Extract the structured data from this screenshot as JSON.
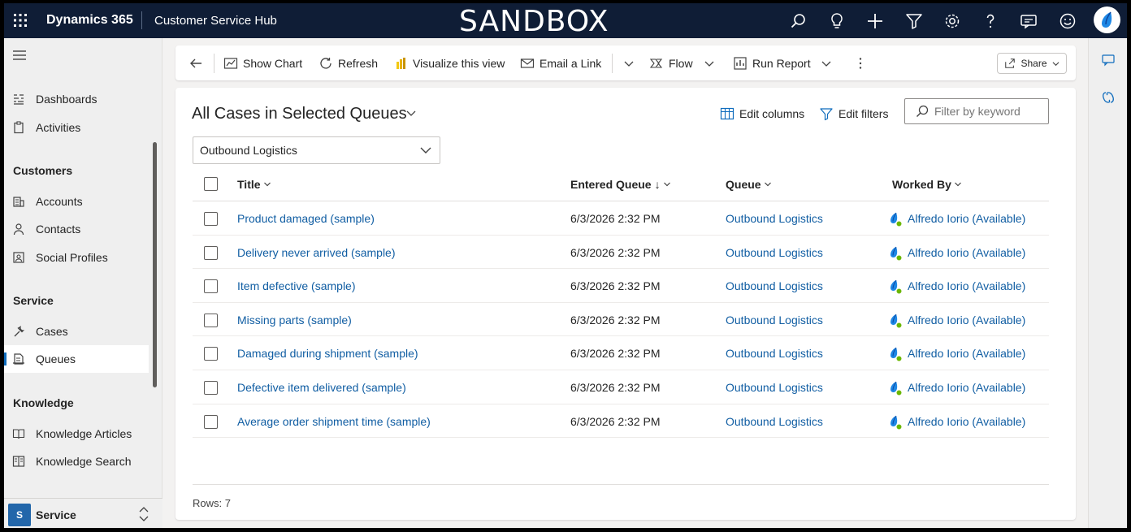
{
  "topbar": {
    "app_title": "Dynamics 365",
    "app_name": "Customer Service Hub",
    "environment_banner": "SANDBOX",
    "icons": [
      "search-icon",
      "lightbulb-icon",
      "plus-icon",
      "filter-icon",
      "gear-icon",
      "help-icon",
      "chat-icon",
      "smiley-icon"
    ]
  },
  "nav": {
    "items_top": [
      {
        "label": "Dashboards",
        "icon": "dashboard-icon"
      },
      {
        "label": "Activities",
        "icon": "clipboard-icon"
      }
    ],
    "sections": [
      {
        "title": "Customers",
        "items": [
          {
            "label": "Accounts",
            "icon": "building-icon"
          },
          {
            "label": "Contacts",
            "icon": "person-icon"
          },
          {
            "label": "Social Profiles",
            "icon": "profile-icon"
          }
        ]
      },
      {
        "title": "Service",
        "items": [
          {
            "label": "Cases",
            "icon": "wrench-icon"
          },
          {
            "label": "Queues",
            "icon": "queue-icon",
            "active": true
          }
        ]
      },
      {
        "title": "Knowledge",
        "items": [
          {
            "label": "Knowledge Articles",
            "icon": "book-icon"
          },
          {
            "label": "Knowledge Search",
            "icon": "book-search-icon"
          }
        ]
      }
    ],
    "area": {
      "badge": "S",
      "label": "Service"
    }
  },
  "commandbar": {
    "show_chart": "Show Chart",
    "refresh": "Refresh",
    "visualize": "Visualize this view",
    "email_link": "Email a Link",
    "flow": "Flow",
    "run_report": "Run Report",
    "share": "Share"
  },
  "view": {
    "title": "All Cases in Selected Queues",
    "edit_columns": "Edit columns",
    "edit_filters": "Edit filters",
    "filter_placeholder": "Filter by keyword",
    "queue_selected": "Outbound Logistics"
  },
  "grid": {
    "columns": [
      "Title",
      "Entered Queue",
      "Queue",
      "Worked By"
    ],
    "sort_indicator": "↓",
    "rows": [
      {
        "title": "Product damaged (sample)",
        "entered": "6/3/2026 2:32 PM",
        "queue": "Outbound Logistics",
        "worked_by": "Alfredo Iorio (Available)"
      },
      {
        "title": "Delivery never arrived (sample)",
        "entered": "6/3/2026 2:32 PM",
        "queue": "Outbound Logistics",
        "worked_by": "Alfredo Iorio (Available)"
      },
      {
        "title": "Item defective (sample)",
        "entered": "6/3/2026 2:32 PM",
        "queue": "Outbound Logistics",
        "worked_by": "Alfredo Iorio (Available)"
      },
      {
        "title": "Missing parts (sample)",
        "entered": "6/3/2026 2:32 PM",
        "queue": "Outbound Logistics",
        "worked_by": "Alfredo Iorio (Available)"
      },
      {
        "title": "Damaged during shipment (sample)",
        "entered": "6/3/2026 2:32 PM",
        "queue": "Outbound Logistics",
        "worked_by": "Alfredo Iorio (Available)"
      },
      {
        "title": "Defective item delivered (sample)",
        "entered": "6/3/2026 2:32 PM",
        "queue": "Outbound Logistics",
        "worked_by": "Alfredo Iorio (Available)"
      },
      {
        "title": "Average order shipment time (sample)",
        "entered": "6/3/2026 2:32 PM",
        "queue": "Outbound Logistics",
        "worked_by": "Alfredo Iorio (Available)"
      }
    ],
    "rows_label": "Rows: 7"
  },
  "colors": {
    "topbar": "#0f1d36",
    "link": "#115ea3",
    "presence_available": "#6bb700",
    "accent": "#0f6cbd"
  }
}
